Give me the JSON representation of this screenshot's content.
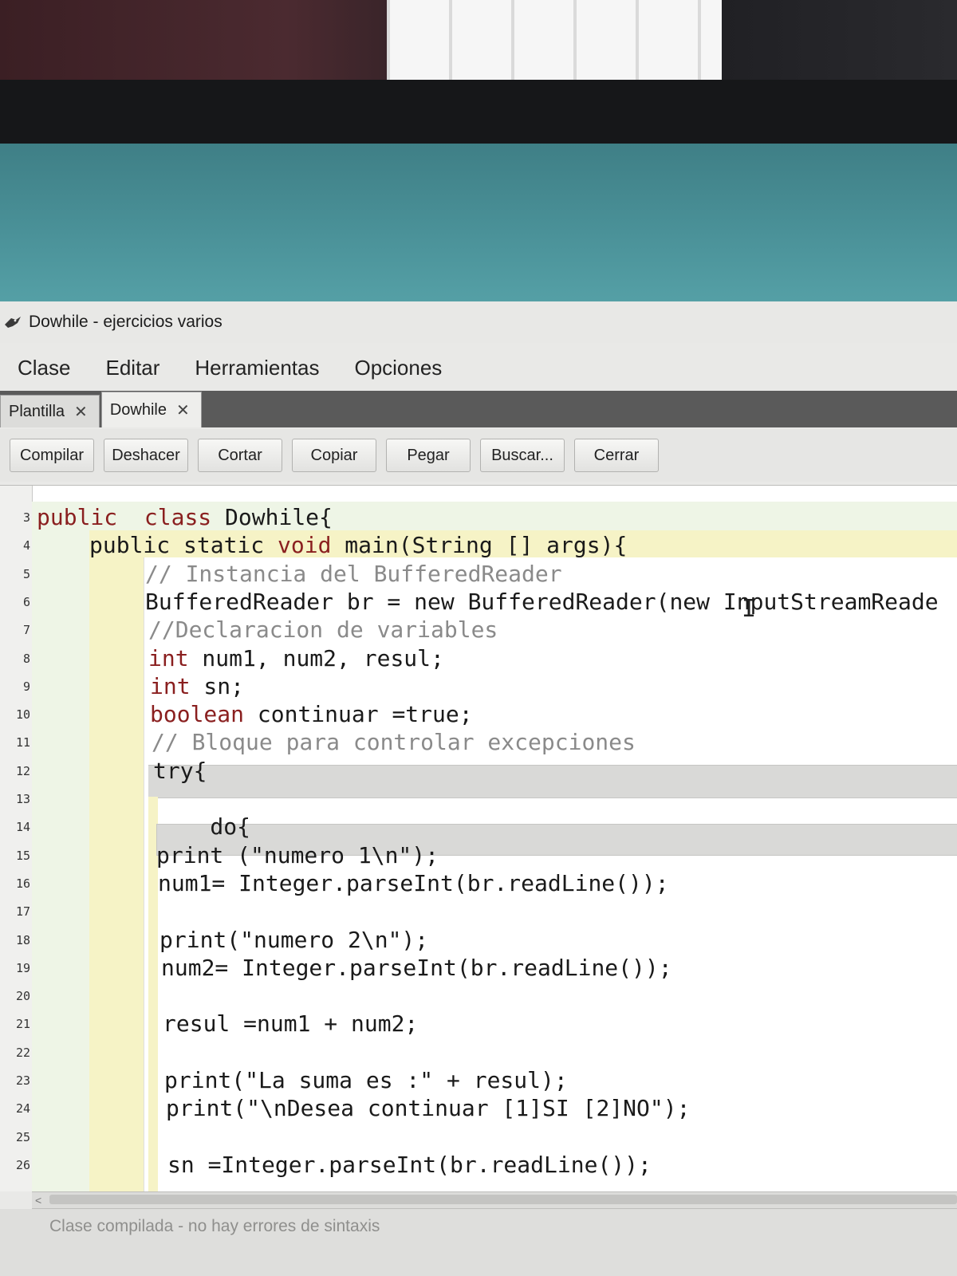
{
  "window": {
    "title": "Dowhile - ejercicios varios"
  },
  "menu": [
    "Clase",
    "Editar",
    "Herramientas",
    "Opciones"
  ],
  "tabs": [
    {
      "label": "Plantilla",
      "close": "✕",
      "active": false
    },
    {
      "label": "Dowhile",
      "close": "✕",
      "active": true
    }
  ],
  "toolbar": {
    "compile": "Compilar",
    "undo": "Deshacer",
    "cut": "Cortar",
    "copy": "Copiar",
    "paste": "Pegar",
    "find": "Buscar...",
    "close": "Cerrar"
  },
  "editor": {
    "lines": [
      {
        "n": "3",
        "parts": [
          [
            "kw",
            "public"
          ],
          [
            "",
            "  "
          ],
          [
            "kw",
            "class"
          ],
          [
            "",
            " Dowhile{"
          ]
        ]
      },
      {
        "n": "4",
        "parts": [
          [
            "",
            "public static "
          ],
          [
            "kw",
            "void"
          ],
          [
            "",
            " main(String [] args){"
          ]
        ]
      },
      {
        "n": "5",
        "parts": [
          [
            "cm",
            "// Instancia del BufferedReader"
          ]
        ]
      },
      {
        "n": "6",
        "parts": [
          [
            "",
            "BufferedReader br = new BufferedReader(new InputStreamReade"
          ]
        ]
      },
      {
        "n": "7",
        "parts": [
          [
            "cm",
            "//Declaracion de variables"
          ]
        ]
      },
      {
        "n": "8",
        "parts": [
          [
            "kw",
            "int"
          ],
          [
            "",
            " num1, num2, resul;"
          ]
        ]
      },
      {
        "n": "9",
        "parts": [
          [
            "kw",
            "int"
          ],
          [
            "",
            " sn;"
          ]
        ]
      },
      {
        "n": "10",
        "parts": [
          [
            "kw",
            "boolean"
          ],
          [
            "",
            " continuar =true;"
          ]
        ]
      },
      {
        "n": "11",
        "parts": [
          [
            "cm",
            "// Bloque para controlar excepciones"
          ]
        ]
      },
      {
        "n": "12",
        "parts": [
          [
            "",
            "try{"
          ]
        ]
      },
      {
        "n": "13",
        "parts": [
          [
            "",
            ""
          ]
        ]
      },
      {
        "n": "14",
        "parts": [
          [
            "",
            "    do{"
          ]
        ]
      },
      {
        "n": "15",
        "parts": [
          [
            "",
            "print (\"numero 1\\n\");"
          ]
        ]
      },
      {
        "n": "16",
        "parts": [
          [
            "",
            "num1= Integer.parseInt(br.readLine());"
          ]
        ]
      },
      {
        "n": "17",
        "parts": [
          [
            "",
            ""
          ]
        ]
      },
      {
        "n": "18",
        "parts": [
          [
            "",
            "print(\"numero 2\\n\");"
          ]
        ]
      },
      {
        "n": "19",
        "parts": [
          [
            "",
            "num2= Integer.parseInt(br.readLine());"
          ]
        ]
      },
      {
        "n": "20",
        "parts": [
          [
            "",
            ""
          ]
        ]
      },
      {
        "n": "21",
        "parts": [
          [
            "",
            "resul =num1 + num2;"
          ]
        ]
      },
      {
        "n": "22",
        "parts": [
          [
            "",
            ""
          ]
        ]
      },
      {
        "n": "23",
        "parts": [
          [
            "",
            "print(\"La suma es :\" + resul);"
          ]
        ]
      },
      {
        "n": "24",
        "parts": [
          [
            "",
            "print(\"\\nDesea continuar [1]SI [2]NO\");"
          ]
        ]
      },
      {
        "n": "25",
        "parts": [
          [
            "",
            ""
          ]
        ]
      },
      {
        "n": "26",
        "parts": [
          [
            "",
            "sn =Integer.parseInt(br.readLine());"
          ]
        ]
      }
    ]
  },
  "status": {
    "message": "Clase compilada - no hay errores de sintaxis"
  }
}
